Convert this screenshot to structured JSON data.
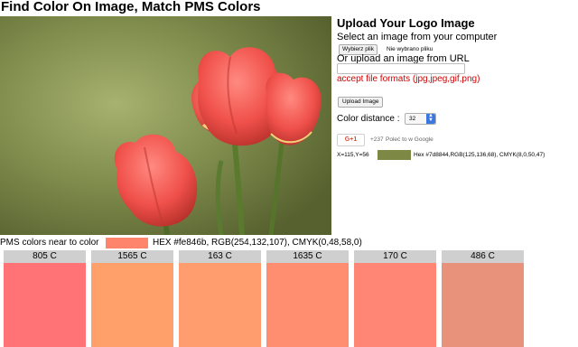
{
  "page": {
    "title": "Find Color On Image, Match PMS Colors"
  },
  "upload": {
    "heading": "Upload Your Logo Image",
    "select_label": "Select an image from your computer",
    "file_button": "Wybierz plik",
    "file_status": "Nie wybrano pliku",
    "url_label": "Or upload an image from URL",
    "url_value": "",
    "formats_note": "accept file formats (jpg,jpeg,gif,png)",
    "upload_button": "Upload Image"
  },
  "distance": {
    "label": "Color distance :",
    "value": "32"
  },
  "social": {
    "gplus_label": "G+1",
    "gplus_count": "+237",
    "gplus_text": "Poleć to w Google"
  },
  "picked": {
    "coords": "X=115,Y=56",
    "color": "#7d8844",
    "info": "Hex #7d8844,RGB(125,136,68), CMYK(8,0,50,47)"
  },
  "near": {
    "label": "PMS colors near to color",
    "color": "#fe846b",
    "info": "HEX #fe846b, RGB(254,132,107), CMYK(0,48,58,0)"
  },
  "pms_cards": [
    {
      "name": "805 C",
      "color": "#ff7276"
    },
    {
      "name": "1565 C",
      "color": "#ffa06a"
    },
    {
      "name": "163 C",
      "color": "#ff9d6e"
    },
    {
      "name": "1635 C",
      "color": "#ff8e70"
    },
    {
      "name": "170 C",
      "color": "#ff8674"
    },
    {
      "name": "486 C",
      "color": "#e8927c"
    }
  ]
}
